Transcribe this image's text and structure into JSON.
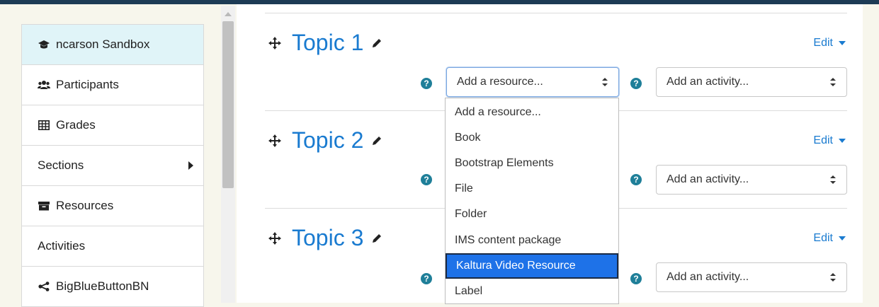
{
  "sidebar": {
    "items": [
      {
        "label": "ncarson Sandbox",
        "icon": "graduation-cap-icon"
      },
      {
        "label": "Participants",
        "icon": "users-icon"
      },
      {
        "label": "Grades",
        "icon": "table-icon"
      },
      {
        "label": "Sections",
        "icon": ""
      },
      {
        "label": "Resources",
        "icon": "archive-icon"
      },
      {
        "label": "Activities",
        "icon": ""
      },
      {
        "label": "BigBlueButtonBN",
        "icon": "share-icon"
      }
    ]
  },
  "topics": [
    {
      "title": "Topic 1",
      "edit": "Edit",
      "resource_select": "Add a resource...",
      "activity_select": "Add an activity..."
    },
    {
      "title": "Topic 2",
      "edit": "Edit",
      "activity_select": "Add an activity..."
    },
    {
      "title": "Topic 3",
      "edit": "Edit",
      "activity_select": "Add an activity..."
    }
  ],
  "resource_dropdown": {
    "options": [
      "Add a resource...",
      "Book",
      "Bootstrap Elements",
      "File",
      "Folder",
      "IMS content package",
      "Kaltura Video Resource",
      "Label"
    ],
    "highlighted": "Kaltura Video Resource"
  },
  "colors": {
    "accent": "#1a7bd0",
    "highlight": "#1e72e8",
    "help": "#1f7f99",
    "active_nav": "#e0f4f8",
    "header": "#1d3b55"
  }
}
